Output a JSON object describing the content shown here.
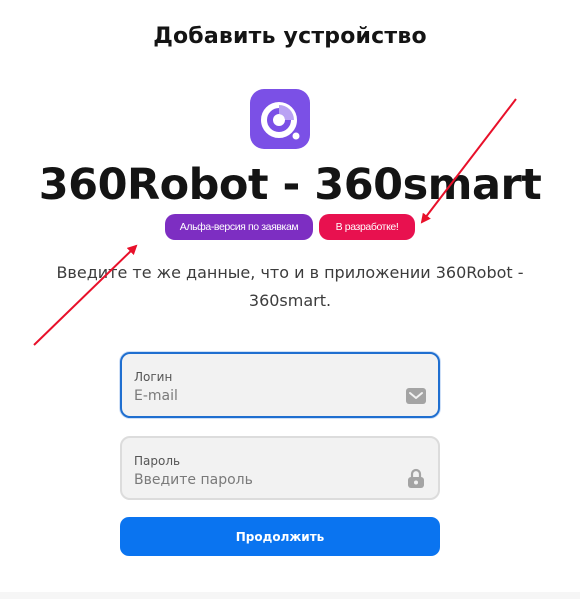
{
  "header": {
    "title": "Добавить устройство"
  },
  "app": {
    "icon": "app-logo-icon",
    "name": "360Robot - 360smart",
    "badges": {
      "alpha": "Альфа-версия по заявкам",
      "dev": "В разработке!"
    }
  },
  "description": "Введите те же данные, что и в приложении 360Robot - 360smart.",
  "form": {
    "login": {
      "label": "Логин",
      "placeholder": "E-mail",
      "icon": "envelope-icon"
    },
    "password": {
      "label": "Пароль",
      "placeholder": "Введите пароль",
      "icon": "lock-icon"
    },
    "submit_label": "Продолжить"
  },
  "colors": {
    "logo": "#7b50e6",
    "badge_alpha": "#7d2ec2",
    "badge_dev": "#e8114f",
    "focus_border": "#1f6fd0",
    "primary_button": "#0a74f0",
    "annotation_arrow": "#e8102a"
  }
}
